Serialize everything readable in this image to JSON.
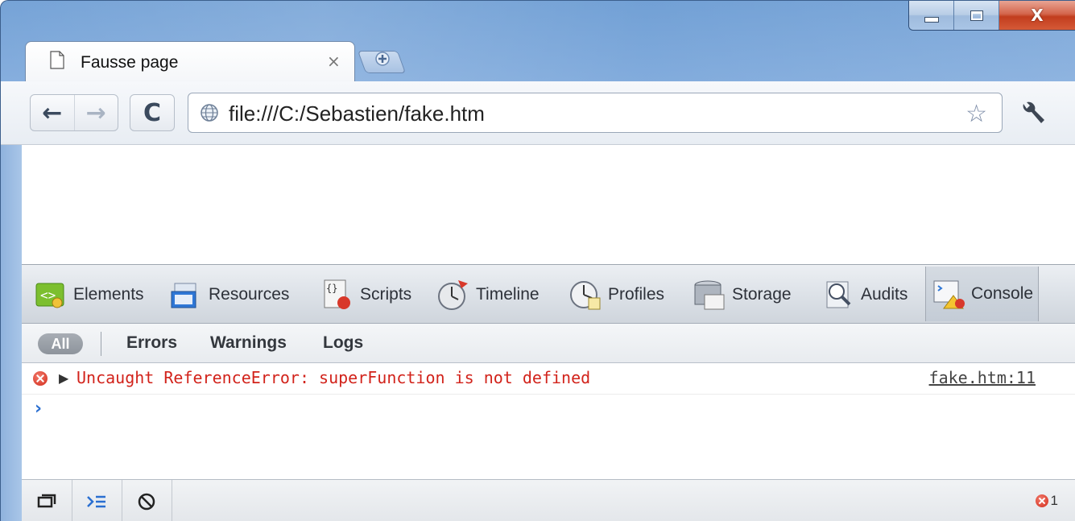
{
  "window": {
    "controls": {
      "minimize": "minimize-icon",
      "maximize": "maximize-icon",
      "close": "close-icon",
      "close_glyph": "X"
    }
  },
  "tab": {
    "title": "Fausse page",
    "close_glyph": "×",
    "page_icon": "page-icon"
  },
  "toolbar": {
    "back_glyph": "←",
    "forward_glyph": "→",
    "reload_glyph": "C",
    "url": "file:///C:/Sebastien/fake.htm",
    "star_glyph": "☆"
  },
  "devtools": {
    "tabs": [
      {
        "label": "Elements",
        "icon": "elements-icon"
      },
      {
        "label": "Resources",
        "icon": "resources-icon"
      },
      {
        "label": "Scripts",
        "icon": "scripts-icon"
      },
      {
        "label": "Timeline",
        "icon": "timeline-icon"
      },
      {
        "label": "Profiles",
        "icon": "profiles-icon"
      },
      {
        "label": "Storage",
        "icon": "storage-icon"
      },
      {
        "label": "Audits",
        "icon": "audits-icon"
      },
      {
        "label": "Console",
        "icon": "console-icon",
        "active": true
      }
    ],
    "filters": {
      "all": "All",
      "errors": "Errors",
      "warnings": "Warnings",
      "logs": "Logs"
    },
    "console": {
      "messages": [
        {
          "level": "error",
          "text": "Uncaught ReferenceError: superFunction is not defined",
          "source": "fake.htm:11"
        }
      ],
      "prompt": "›"
    },
    "status": {
      "error_count": "1"
    }
  },
  "colors": {
    "error_red": "#d2231b",
    "prompt_blue": "#2a6fd1",
    "frame_blue": "#7ea9dc"
  }
}
